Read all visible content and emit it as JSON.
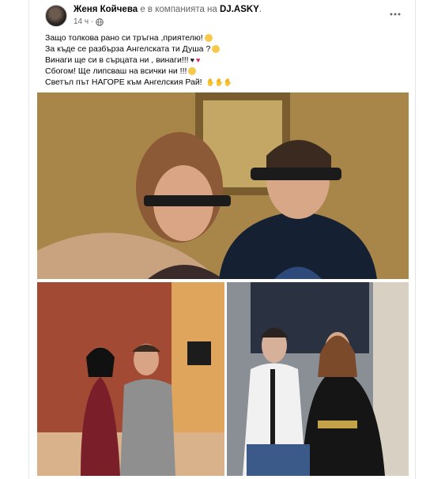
{
  "post": {
    "author": "Женя Койчева",
    "with_text": " е в компанията на ",
    "tagged": "DJ.ASKY",
    "tagged_suffix": ".",
    "time": "14 ч",
    "separator": "·",
    "more_icon": "more-dots-icon",
    "privacy_icon": "globe-icon",
    "lines": [
      "Защо толкова рано си тръгна ,приятелю!",
      "За къде се разбърза Ангелската ти Душа ?",
      "Винаги ще си в сърцата ни , винаги!!!",
      "Сбогом! Ще липсваш на всички ни !!!",
      "Светъл път НАГОРЕ към Ангелския Рай! "
    ],
    "photos": [
      {
        "name": "photo-main",
        "icon": "photo-two-people-headphones"
      },
      {
        "name": "photo-left",
        "icon": "photo-couple-red-curtains"
      },
      {
        "name": "photo-right",
        "icon": "photo-couple-white-shirt"
      }
    ]
  }
}
